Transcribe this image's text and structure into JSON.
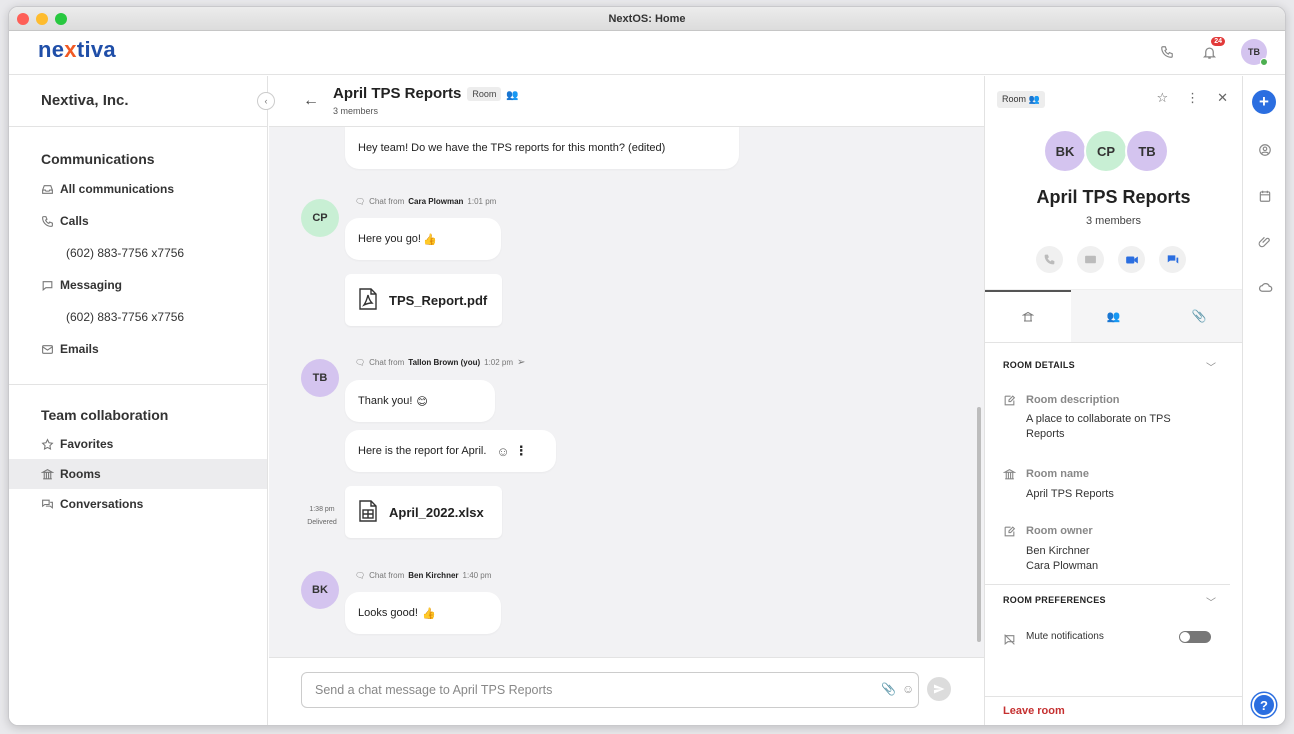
{
  "window": {
    "title": "NextOS: Home"
  },
  "topbar": {
    "logo_pre": "ne",
    "logo_x": "x",
    "logo_post": "tiva",
    "notification_count": "24",
    "user_initials": "TB"
  },
  "sidebar": {
    "org_name": "Nextiva, Inc.",
    "communications": {
      "title": "Communications",
      "items": [
        {
          "label": "All communications",
          "icon": "inbox-icon"
        },
        {
          "label": "Calls",
          "icon": "phone-icon"
        },
        {
          "label": "(602) 883-7756 x7756"
        },
        {
          "label": "Messaging",
          "icon": "chat-icon"
        },
        {
          "label": "(602) 883-7756 x7756"
        },
        {
          "label": "Emails",
          "icon": "mail-icon"
        }
      ]
    },
    "team": {
      "title": "Team collaboration",
      "items": [
        {
          "label": "Favorites",
          "icon": "star-icon"
        },
        {
          "label": "Rooms",
          "icon": "building-icon"
        },
        {
          "label": "Conversations",
          "icon": "conversation-icon"
        }
      ]
    }
  },
  "chat": {
    "title": "April TPS Reports",
    "tag": "Room",
    "members": "3 members",
    "messages": {
      "m1": "Hey team! Do we have the TPS reports for this month? (edited)",
      "cp": {
        "initials": "CP",
        "prefix": "Chat from",
        "name": "Cara Plowman",
        "time": "1:01 pm",
        "text": "Here you go!",
        "file": "TPS_Report.pdf"
      },
      "tb": {
        "initials": "TB",
        "prefix": "Chat from",
        "name": "Tallon Brown (you)",
        "time": "1:02 pm",
        "text1": "Thank you!",
        "text2": "Here is the report for April.",
        "file": "April_2022.xlsx",
        "side_time": "1:38 pm",
        "side_status": "Delivered"
      },
      "bk": {
        "initials": "BK",
        "prefix": "Chat from",
        "name": "Ben Kirchner",
        "time": "1:40 pm",
        "text": "Looks good!"
      }
    },
    "composer": {
      "placeholder": "Send a chat message to April TPS Reports"
    }
  },
  "panel": {
    "tag": "Room",
    "avatars": [
      "BK",
      "CP",
      "TB"
    ],
    "title": "April TPS Reports",
    "members": "3 members",
    "details": {
      "title": "ROOM DETAILS",
      "desc_label": "Room description",
      "desc_value": "A place to collaborate on TPS Reports",
      "name_label": "Room name",
      "name_value": "April TPS Reports",
      "owner_label": "Room owner",
      "owners": [
        "Ben Kirchner",
        "Cara Plowman"
      ]
    },
    "prefs": {
      "title": "ROOM PREFERENCES",
      "mute_label": "Mute notifications",
      "mute_on": false
    },
    "leave": "Leave room"
  },
  "colors": {
    "brand_blue": "#1f4ea8",
    "accent_blue": "#2b6ee0",
    "leave_red": "#c53030",
    "cp_avatar": "#c8efd4",
    "tb_avatar": "#d4c4ef",
    "bk_avatar": "#d4c4ef"
  }
}
